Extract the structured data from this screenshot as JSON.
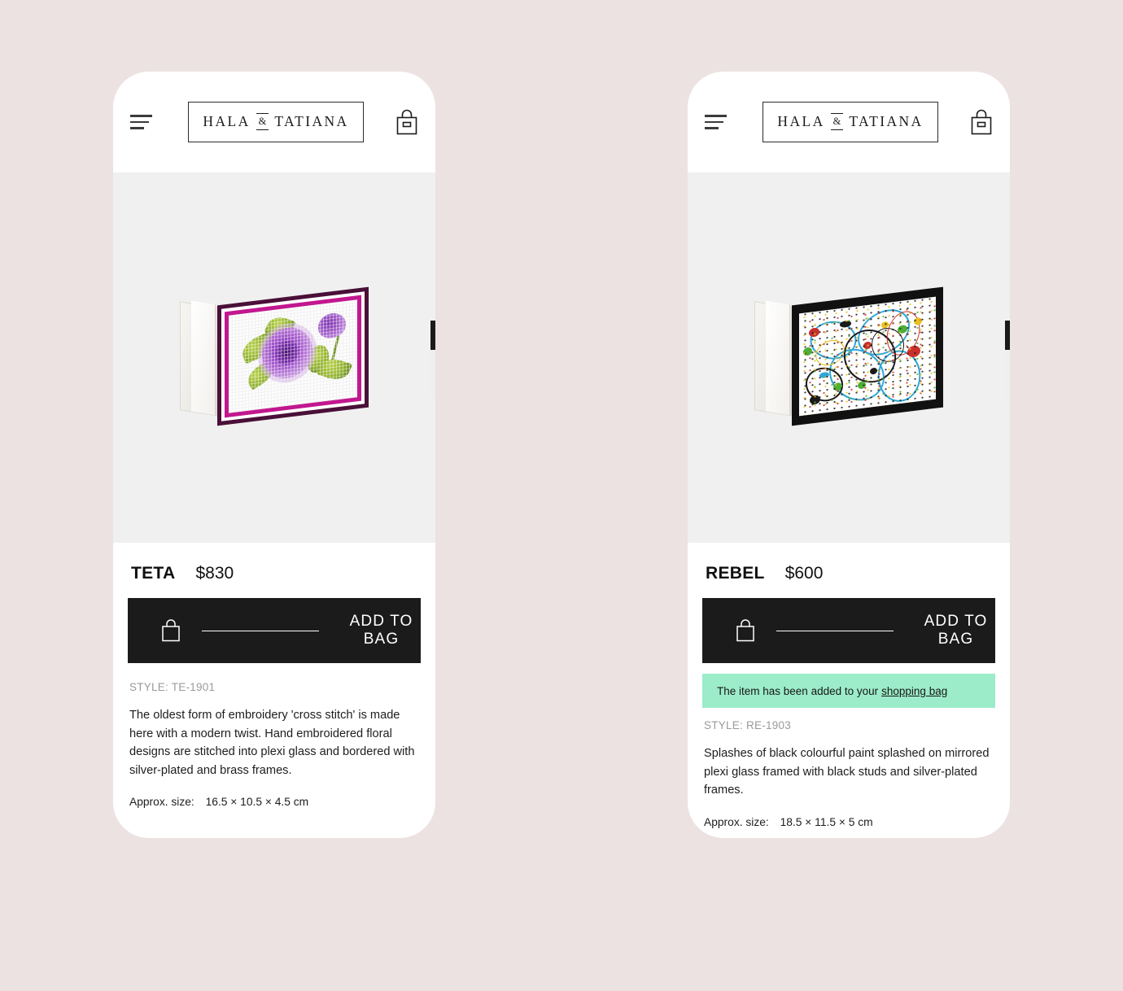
{
  "page": {
    "background_color": "#ece2e1"
  },
  "brand": {
    "name_part1": "HALA",
    "ampersand": "&",
    "name_part2": "TATIANA"
  },
  "icons": {
    "menu": "hamburger-menu-icon",
    "bag": "shopping-bag-icon",
    "button_bag": "shopping-bag-icon"
  },
  "phones": [
    {
      "id": "phone-left",
      "header": {
        "menu_label": "Menu",
        "bag_label": "Shopping bag"
      },
      "product": {
        "name": "TETA",
        "price": "$830",
        "style_label": "STYLE: TE-1901",
        "description": "The oldest form of embroidery 'cross stitch' is made here with a modern twist. Hand embroidered floral designs are stitched into plexi glass and bordered with silver-plated and brass frames.",
        "size_label": "Approx. size:",
        "size_value": "16.5 × 10.5 × 4.5 cm",
        "image_alt": "Purple cross-stitch floral clutch bag"
      },
      "add_to_bag": {
        "label": "ADD TO BAG",
        "background_color": "#1b1b1b"
      },
      "notice": null
    },
    {
      "id": "phone-right",
      "header": {
        "menu_label": "Menu",
        "bag_label": "Shopping bag"
      },
      "product": {
        "name": "REBEL",
        "price": "$600",
        "style_label": "STYLE: RE-1903",
        "description": "Splashes of black colourful paint splashed on mirrored plexi glass framed with black studs and silver-plated frames.",
        "size_label": "Approx. size:",
        "size_value": "18.5 × 11.5 × 5 cm",
        "image_alt": "Black paint-splatter clutch bag"
      },
      "add_to_bag": {
        "label": "ADD TO BAG",
        "background_color": "#1b1b1b"
      },
      "notice": {
        "text": "The item has been added to your",
        "link_text": "shopping bag",
        "background_color": "#9cecca"
      }
    }
  ]
}
